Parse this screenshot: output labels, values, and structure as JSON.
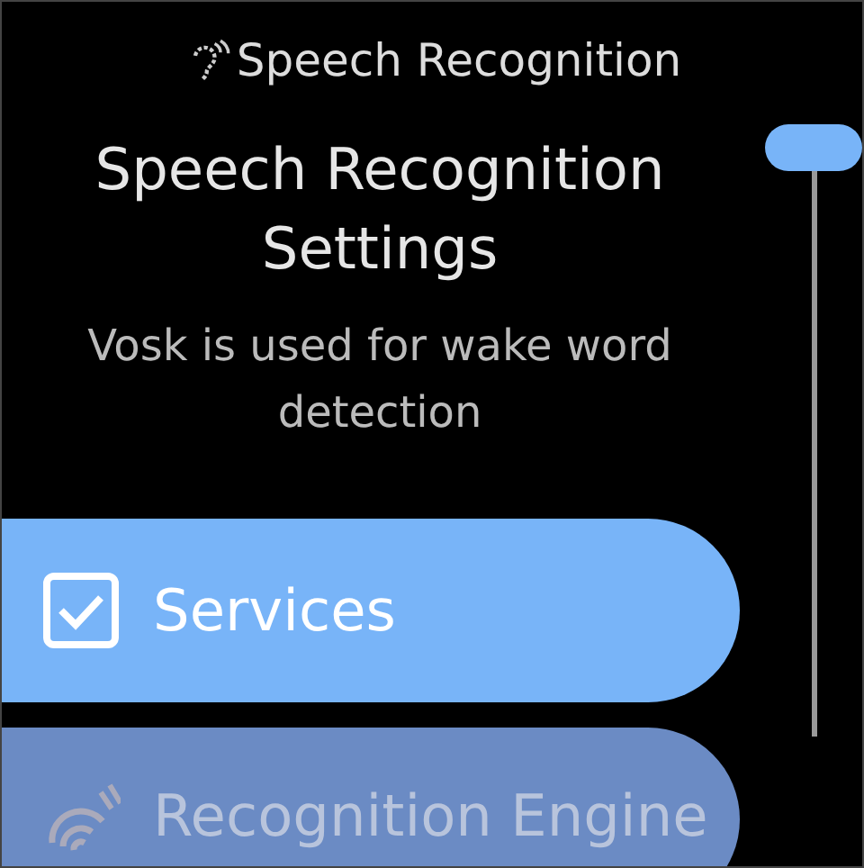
{
  "header": {
    "title": "Speech Recognition"
  },
  "heading": "Speech Recognition Settings",
  "description": "Vosk is used for wake word detection",
  "items": [
    {
      "label": "Services",
      "kind": "check",
      "selected": true
    },
    {
      "label": "Recognition Engine",
      "kind": "signal",
      "selected": false
    }
  ]
}
